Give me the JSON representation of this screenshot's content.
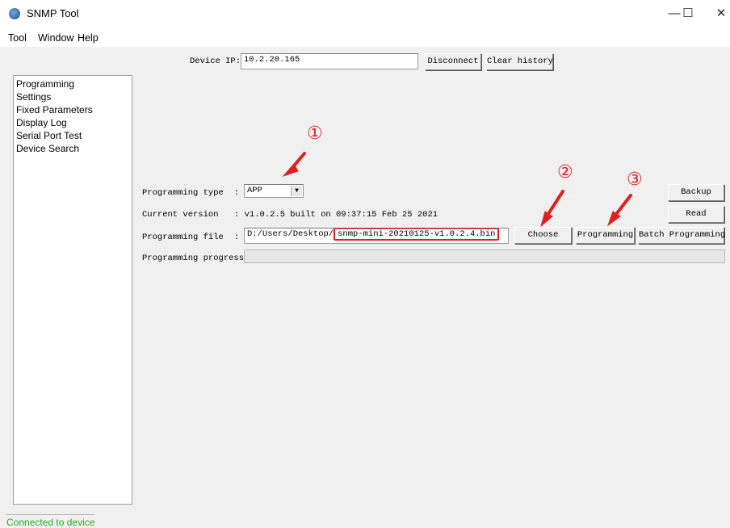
{
  "window": {
    "title": "SNMP Tool",
    "minimize": "—",
    "maximize": "☐",
    "close": "✕"
  },
  "menu": [
    "Tool",
    "Window",
    "Help"
  ],
  "device": {
    "label": "Device IP:",
    "ip": "10.2.20.165",
    "disconnect": "Disconnect",
    "clear_history": "Clear history"
  },
  "sidebar": {
    "items": [
      "Programming",
      "Settings",
      "Fixed Parameters",
      "Display Log",
      "Serial Port Test",
      "Device Search"
    ]
  },
  "form": {
    "programming_type": {
      "label": "Programming type",
      "sep": ":",
      "value": "APP"
    },
    "current_version": {
      "label": "Current version",
      "value": ": v1.0.2.5 built on 09:37:15 Feb 25 2021"
    },
    "programming_file": {
      "label": "Programming file",
      "sep": ":",
      "path_prefix": "D:/Users/Desktop/",
      "filename": "snmp-mini-20210125-v1.0.2.4.bin"
    },
    "programming_progress": {
      "label": "Programming progress:",
      "value": 0
    }
  },
  "buttons": {
    "choose": "Choose",
    "programming": "Programming",
    "batch_programming": "Batch Programming",
    "backup": "Backup",
    "read": "Read"
  },
  "annotations": {
    "one": "①",
    "two": "②",
    "three": "③",
    "color": "#e02020"
  },
  "status": {
    "text": "Connected to device",
    "color": "#22b022"
  }
}
